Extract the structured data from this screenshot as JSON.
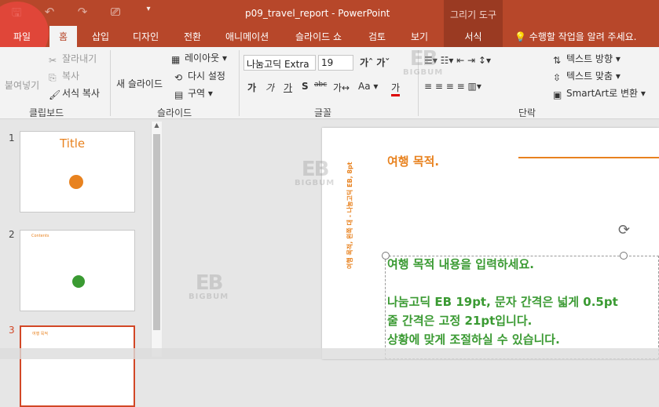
{
  "window": {
    "title": "p09_travel_report - PowerPoint",
    "context_group": "그리기 도구"
  },
  "qat": {
    "save_icon": "save-icon",
    "undo_icon": "undo-icon",
    "redo_icon": "redo-icon",
    "present_icon": "present-icon",
    "more_icon": "chevron-down-icon"
  },
  "tabs": {
    "file": "파일",
    "home": "홈",
    "insert": "삽입",
    "design": "디자인",
    "transitions": "전환",
    "animations": "애니메이션",
    "slideshow": "슬라이드 쇼",
    "review": "검토",
    "view": "보기",
    "format": "서식",
    "tellme": "수행할 작업을 알려 주세요."
  },
  "ribbon": {
    "clipboard": {
      "label": "클립보드",
      "paste": "붙여넣기",
      "cut": "잘라내기",
      "copy": "복사",
      "format_painter": "서식 복사"
    },
    "slides": {
      "label": "슬라이드",
      "new_slide": "새 슬라이드",
      "layout": "레이아웃",
      "reset": "다시 설정",
      "section": "구역"
    },
    "font": {
      "label": "글꼴",
      "font_name": "나눔고딕 Extra",
      "font_size": "19"
    },
    "paragraph": {
      "label": "단락",
      "text_direction": "텍스트 방향",
      "align_text": "텍스트 맞춤",
      "smartart": "SmartArt로 변환"
    }
  },
  "thumbnails": [
    {
      "num": "1",
      "title": "Title"
    },
    {
      "num": "2",
      "title": "Contents"
    },
    {
      "num": "3",
      "title": "여행 목적"
    }
  ],
  "slide": {
    "title": "여행 목적.",
    "body": [
      "여행 목적 내용을 입력하세요.",
      "",
      "나눔고딕 EB 19pt, 문자 간격은 넓게 0.5pt",
      "줄 간격은 고정 21pt입니다.",
      "상황에 맞게 조절하실 수 있습니다."
    ],
    "side_text": "여행 목적, 왼쪽 대 - 나눔고딕 EB, 8pt"
  },
  "watermark": {
    "logo": "EB",
    "text": "BIGBUM"
  },
  "colors": {
    "accent": "#b7472a",
    "title_orange": "#e8821f",
    "body_green": "#3a9a32",
    "file_highlight": "#e8463c"
  }
}
